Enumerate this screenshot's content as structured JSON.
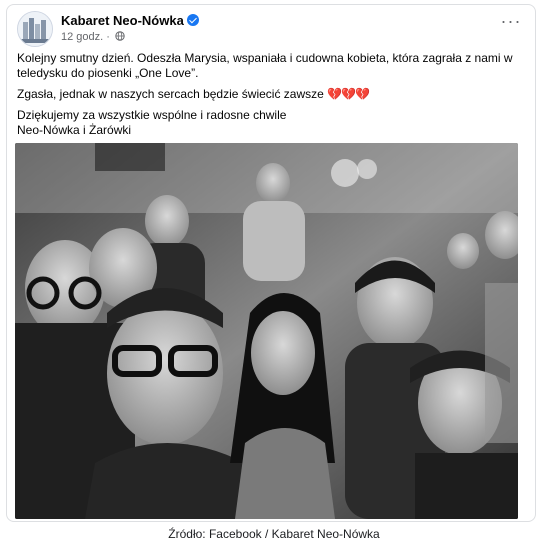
{
  "post": {
    "page_name": "Kabaret Neo-Nówka",
    "timestamp": "12 godz.",
    "separator": "·",
    "icons": {
      "verified": "verified-badge-icon",
      "privacy": "globe-icon",
      "more": "more-options-icon",
      "hearts": "broken-heart-icon"
    },
    "accent_color": "#1877f2",
    "text": {
      "line1": "Kolejny smutny dzień. Odeszła Marysia, wspaniała i cudowna kobieta, która zagrała z nami w teledysku do piosenki „One Love”.",
      "line2": "Zgasła, jednak w naszych sercach będzie świecić zawsze",
      "hearts": "💔💔💔",
      "line3": "Dziękujemy za wszystkie wspólne i radosne chwile",
      "line4": "Neo-Nówka i Żarówki"
    }
  },
  "caption": "Źródło: Facebook / Kabaret Neo-Nówka"
}
